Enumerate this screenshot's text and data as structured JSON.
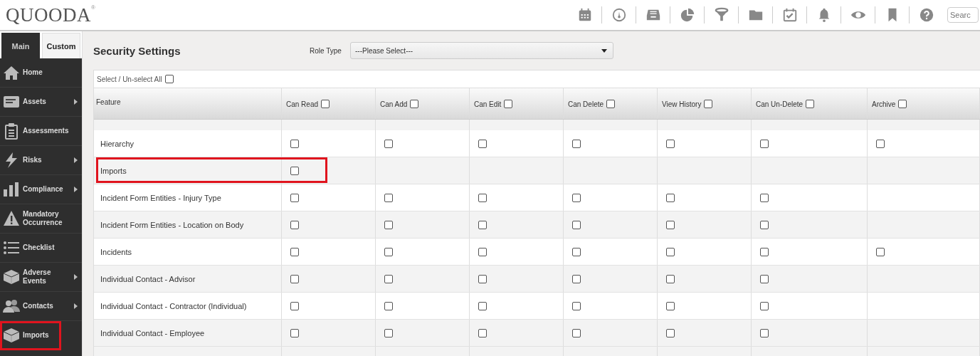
{
  "header": {
    "logo": "QUOODA",
    "logo_mark": "®",
    "search": {
      "placeholder": "Searc"
    }
  },
  "sidebar": {
    "tabs": [
      {
        "label": "Main",
        "selected": true
      },
      {
        "label": "Custom",
        "selected": false
      }
    ],
    "items": [
      {
        "label": "Home",
        "submenu": false,
        "highlighted": false
      },
      {
        "label": "Assets",
        "submenu": true,
        "highlighted": false
      },
      {
        "label": "Assessments",
        "submenu": false,
        "highlighted": false
      },
      {
        "label": "Risks",
        "submenu": true,
        "highlighted": false
      },
      {
        "label": "Compliance",
        "submenu": true,
        "highlighted": false
      },
      {
        "label": "Mandatory Occurrence",
        "submenu": false,
        "highlighted": false
      },
      {
        "label": "Checklist",
        "submenu": false,
        "highlighted": false
      },
      {
        "label": "Adverse Events",
        "submenu": true,
        "highlighted": false
      },
      {
        "label": "Contacts",
        "submenu": true,
        "highlighted": false
      },
      {
        "label": "Imports",
        "submenu": false,
        "highlighted": true
      }
    ]
  },
  "page": {
    "title": "Security Settings",
    "role_type": {
      "label": "Role Type",
      "value": "---Please Select---"
    },
    "select_all": {
      "label": "Select / Un-select All",
      "checked": false
    }
  },
  "table": {
    "columns": [
      {
        "label": "Feature",
        "checkbox": false
      },
      {
        "label": "Can Read",
        "checkbox": true,
        "checked": false
      },
      {
        "label": "Can Add",
        "checkbox": true,
        "checked": false
      },
      {
        "label": "Can Edit",
        "checkbox": true,
        "checked": false
      },
      {
        "label": "Can Delete",
        "checkbox": true,
        "checked": false
      },
      {
        "label": "View History",
        "checkbox": true,
        "checked": false
      },
      {
        "label": "Can Un-Delete",
        "checkbox": true,
        "checked": false
      },
      {
        "label": "Archive",
        "checkbox": true,
        "checked": false
      }
    ],
    "rows": [
      {
        "feature": "Hierarchy",
        "highlighted": false,
        "cells": [
          {
            "kind": "checkbox",
            "checked": false
          },
          {
            "kind": "checkbox",
            "checked": false
          },
          {
            "kind": "checkbox",
            "checked": false
          },
          {
            "kind": "checkbox",
            "checked": false
          },
          {
            "kind": "checkbox",
            "checked": false
          },
          {
            "kind": "checkbox",
            "checked": false
          },
          {
            "kind": "checkbox",
            "checked": false
          }
        ]
      },
      {
        "feature": "Imports",
        "highlighted": true,
        "cells": [
          {
            "kind": "checkbox",
            "checked": false
          },
          {
            "kind": "empty"
          },
          {
            "kind": "empty"
          },
          {
            "kind": "empty"
          },
          {
            "kind": "empty"
          },
          {
            "kind": "empty"
          },
          {
            "kind": "empty"
          }
        ]
      },
      {
        "feature": "Incident Form Entities - Injury Type",
        "highlighted": false,
        "cells": [
          {
            "kind": "checkbox",
            "checked": false
          },
          {
            "kind": "checkbox",
            "checked": false
          },
          {
            "kind": "checkbox",
            "checked": false
          },
          {
            "kind": "checkbox",
            "checked": false
          },
          {
            "kind": "checkbox",
            "checked": false
          },
          {
            "kind": "checkbox",
            "checked": false
          },
          {
            "kind": "empty"
          }
        ]
      },
      {
        "feature": "Incident Form Entities - Location on Body",
        "highlighted": false,
        "cells": [
          {
            "kind": "checkbox",
            "checked": false
          },
          {
            "kind": "checkbox",
            "checked": false
          },
          {
            "kind": "checkbox",
            "checked": false
          },
          {
            "kind": "checkbox",
            "checked": false
          },
          {
            "kind": "checkbox",
            "checked": false
          },
          {
            "kind": "checkbox",
            "checked": false
          },
          {
            "kind": "empty"
          }
        ]
      },
      {
        "feature": "Incidents",
        "highlighted": false,
        "cells": [
          {
            "kind": "checkbox",
            "checked": false
          },
          {
            "kind": "checkbox",
            "checked": false
          },
          {
            "kind": "checkbox",
            "checked": false
          },
          {
            "kind": "checkbox",
            "checked": false
          },
          {
            "kind": "checkbox",
            "checked": false
          },
          {
            "kind": "checkbox",
            "checked": false
          },
          {
            "kind": "checkbox",
            "checked": false
          }
        ]
      },
      {
        "feature": "Individual Contact - Advisor",
        "highlighted": false,
        "cells": [
          {
            "kind": "checkbox",
            "checked": false
          },
          {
            "kind": "checkbox",
            "checked": false
          },
          {
            "kind": "checkbox",
            "checked": false
          },
          {
            "kind": "checkbox",
            "checked": false
          },
          {
            "kind": "checkbox",
            "checked": false
          },
          {
            "kind": "checkbox",
            "checked": false
          },
          {
            "kind": "empty"
          }
        ]
      },
      {
        "feature": "Individual Contact - Contractor (Individual)",
        "highlighted": false,
        "cells": [
          {
            "kind": "checkbox",
            "checked": false
          },
          {
            "kind": "checkbox",
            "checked": false
          },
          {
            "kind": "checkbox",
            "checked": false
          },
          {
            "kind": "checkbox",
            "checked": false
          },
          {
            "kind": "checkbox",
            "checked": false
          },
          {
            "kind": "checkbox",
            "checked": false
          },
          {
            "kind": "empty"
          }
        ]
      },
      {
        "feature": "Individual Contact - Employee",
        "highlighted": false,
        "cells": [
          {
            "kind": "checkbox",
            "checked": false
          },
          {
            "kind": "checkbox",
            "checked": false
          },
          {
            "kind": "checkbox",
            "checked": false
          },
          {
            "kind": "checkbox",
            "checked": false
          },
          {
            "kind": "checkbox",
            "checked": false
          },
          {
            "kind": "checkbox",
            "checked": false
          },
          {
            "kind": "empty"
          }
        ]
      }
    ]
  }
}
